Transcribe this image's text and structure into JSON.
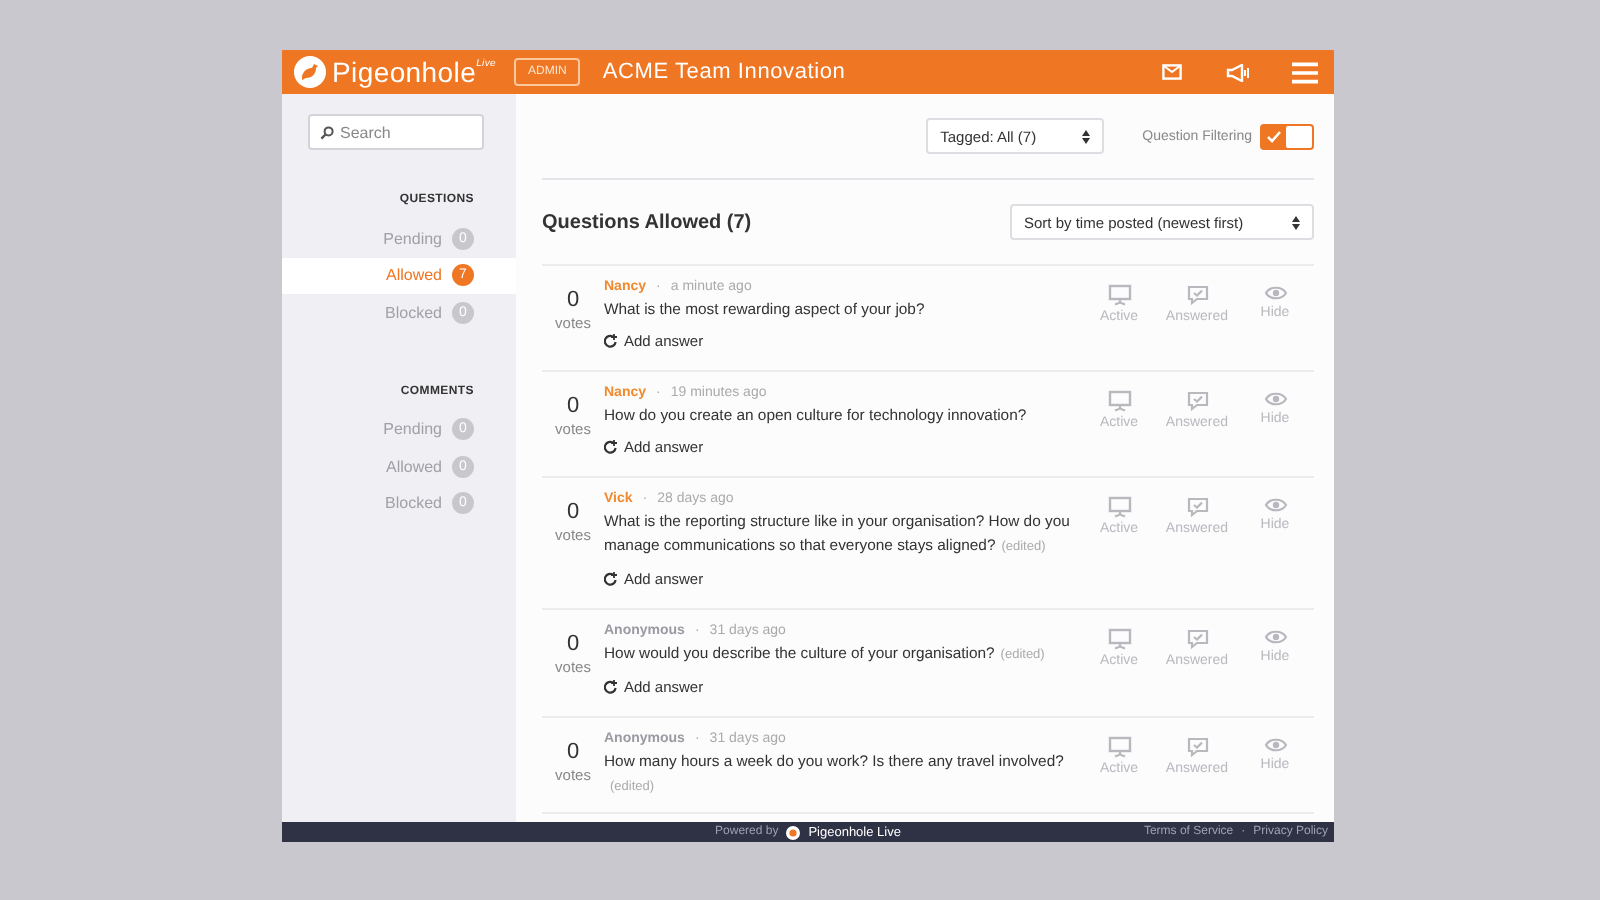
{
  "header": {
    "brand": "Pigeonhole",
    "brand_sup": "Live",
    "role": "ADMIN",
    "title": "ACME Team Innovation"
  },
  "sidebar": {
    "search": {
      "placeholder": "Search"
    },
    "sections": [
      {
        "heading": "QUESTIONS",
        "items": [
          {
            "label": "Pending",
            "count": "0",
            "selected": false
          },
          {
            "label": "Allowed",
            "count": "7",
            "selected": true
          },
          {
            "label": "Blocked",
            "count": "0",
            "selected": false
          }
        ]
      },
      {
        "heading": "COMMENTS",
        "items": [
          {
            "label": "Pending",
            "count": "0",
            "selected": false
          },
          {
            "label": "Allowed",
            "count": "0",
            "selected": false
          },
          {
            "label": "Blocked",
            "count": "0",
            "selected": false
          }
        ]
      }
    ]
  },
  "toolbar": {
    "tag_filter": "Tagged: All (7)",
    "filtering_label": "Question Filtering",
    "filtering_on": true
  },
  "list": {
    "heading": "Questions Allowed (7)",
    "sort": "Sort by time posted (newest first)",
    "questions": [
      {
        "votes": "0",
        "votes_label": "votes",
        "author": "Nancy",
        "color": "#f08a2c",
        "separator": "·",
        "time": "a minute ago",
        "text": "What is the most rewarding aspect of your job?",
        "add_answer": "Add answer",
        "actions": [
          "Active",
          "Answered",
          "Hide"
        ]
      },
      {
        "votes": "0",
        "votes_label": "votes",
        "author": "Nancy",
        "color": "#f08a2c",
        "separator": "·",
        "time": "19 minutes ago",
        "text": "How do you create an open culture for technology innovation?",
        "add_answer": "Add answer",
        "actions": [
          "Active",
          "Answered",
          "Hide"
        ]
      },
      {
        "votes": "0",
        "votes_label": "votes",
        "author": "Vick",
        "color": "#f08a2c",
        "separator": "·",
        "time": "28 days ago",
        "text": "What is the reporting structure like in your organisation? How do you manage communications so that everyone stays aligned?",
        "edited": "(edited)",
        "add_answer": "Add answer",
        "actions": [
          "Active",
          "Answered",
          "Hide"
        ]
      },
      {
        "votes": "0",
        "votes_label": "votes",
        "author": "Anonymous",
        "color": "#9a9aa2",
        "separator": "·",
        "time": "31 days ago",
        "text": "How would you describe the culture of your organisation?",
        "edited": "(edited)",
        "add_answer": "Add answer",
        "actions": [
          "Active",
          "Answered",
          "Hide"
        ]
      },
      {
        "votes": "0",
        "votes_label": "votes",
        "author": "Anonymous",
        "color": "#9a9aa2",
        "separator": "·",
        "time": "31 days ago",
        "text": "How many hours a week do you work? Is there any travel involved?",
        "edited": "(edited)",
        "actions": [
          "Active",
          "Answered",
          "Hide"
        ]
      }
    ]
  },
  "footer": {
    "powered_by": "Powered by",
    "brand": "Pigeonhole Live",
    "links": [
      "Terms of Service",
      "Privacy Policy"
    ],
    "link_separator": "·"
  }
}
